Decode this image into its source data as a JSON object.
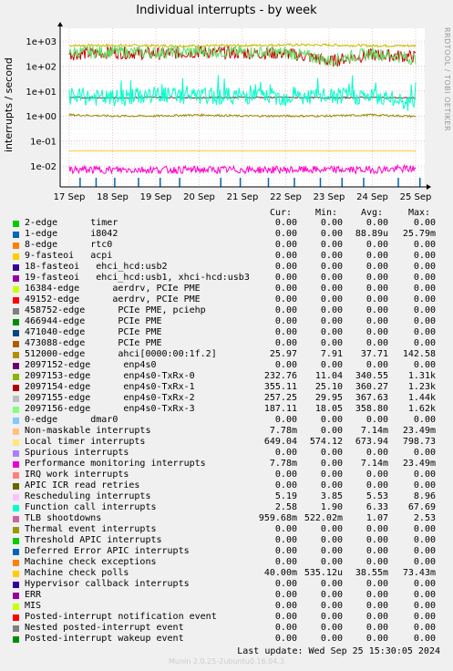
{
  "title": "Individual interrupts - by week",
  "side_label": "RRDTOOL / TOBI OETIKER",
  "ylabel": "interrupts / second",
  "columns": [
    "Cur:",
    "Min:",
    "Avg:",
    "Max:"
  ],
  "footer": "Last update:  Wed Sep 25 15:30:05 2024",
  "munin": "Munin 2.0.25-2ubuntu0.16.04.3",
  "chart_data": {
    "type": "line",
    "title": "Individual interrupts - by week",
    "ylabel": "interrupts / second",
    "yscale": "log",
    "ylim": [
      0.003,
      3000
    ],
    "yticks": [
      "1e+03",
      "1e+02",
      "1e+01",
      "1e+00",
      "1e-01",
      "1e-02"
    ],
    "x": [
      "17 Sep",
      "18 Sep",
      "19 Sep",
      "20 Sep",
      "21 Sep",
      "22 Sep",
      "23 Sep",
      "24 Sep",
      "25 Sep"
    ],
    "grid": true,
    "series": [
      {
        "name": "Local timer interrupts",
        "color": "#CCBB00",
        "values": [
          660,
          670,
          650,
          640,
          660,
          700,
          690,
          650,
          649
        ]
      },
      {
        "name": "2097153-edge enp4s0-TxRx-0",
        "color": "#cc0000",
        "values": [
          300,
          350,
          310,
          360,
          330,
          320,
          150,
          280,
          232
        ]
      },
      {
        "name": "2097156-edge enp4s0-TxRx-3",
        "color": "#66dd66",
        "values": [
          350,
          370,
          340,
          380,
          360,
          340,
          160,
          320,
          187
        ]
      },
      {
        "name": "TLB shootdowns",
        "color": "#998800",
        "values": [
          1.1,
          1.0,
          1.0,
          1.1,
          1.0,
          1.0,
          1.0,
          1.1,
          0.96
        ]
      },
      {
        "name": "Rescheduling interrupts",
        "color": "#664433",
        "values": [
          5.5,
          5.3,
          5.6,
          5.4,
          5.6,
          5.5,
          5.3,
          5.5,
          5.19
        ]
      },
      {
        "name": "Function call interrupts",
        "color": "#00ffcc",
        "values": [
          6.0,
          5.0,
          7.0,
          6.0,
          6.5,
          5.5,
          6.0,
          6.0,
          2.58
        ]
      },
      {
        "name": "Machine check polls",
        "color": "#ffcc33",
        "values": [
          0.04,
          0.04,
          0.04,
          0.04,
          0.04,
          0.04,
          0.04,
          0.04,
          0.04
        ]
      },
      {
        "name": "Non-maskable interrupts",
        "color": "#ff00cc",
        "values": [
          0.007,
          0.007,
          0.007,
          0.007,
          0.007,
          0.007,
          0.007,
          0.007,
          0.0078
        ]
      },
      {
        "name": "1-edge i8042",
        "color": "#0066b3",
        "values": [
          0,
          0,
          0,
          0,
          0,
          0,
          0,
          0,
          0
        ]
      }
    ]
  },
  "legend": [
    {
      "color": "#00cc00",
      "name": "2-edge      timer",
      "cur": "0.00",
      "min": "0.00",
      "avg": "0.00",
      "max": "0.00"
    },
    {
      "color": "#0066b3",
      "name": "1-edge      i8042",
      "cur": "0.00",
      "min": "0.00",
      "avg": "88.89u",
      "max": "25.79m"
    },
    {
      "color": "#ff8000",
      "name": "8-edge      rtc0",
      "cur": "0.00",
      "min": "0.00",
      "avg": "0.00",
      "max": "0.00"
    },
    {
      "color": "#ffcc00",
      "name": "9-fasteoi   acpi",
      "cur": "0.00",
      "min": "0.00",
      "avg": "0.00",
      "max": "0.00"
    },
    {
      "color": "#330099",
      "name": "18-fasteoi   ehci_hcd:usb2",
      "cur": "0.00",
      "min": "0.00",
      "avg": "0.00",
      "max": "0.00"
    },
    {
      "color": "#990099",
      "name": "19-fasteoi   ehci_hcd:usb1, xhci-hcd:usb3",
      "cur": "0.00",
      "min": "0.00",
      "avg": "0.00",
      "max": "0.00"
    },
    {
      "color": "#ccff00",
      "name": "16384-edge      aerdrv, PCIe PME",
      "cur": "0.00",
      "min": "0.00",
      "avg": "0.00",
      "max": "0.00"
    },
    {
      "color": "#ff0000",
      "name": "49152-edge      aerdrv, PCIe PME",
      "cur": "0.00",
      "min": "0.00",
      "avg": "0.00",
      "max": "0.00"
    },
    {
      "color": "#808080",
      "name": "458752-edge      PCIe PME, pciehp",
      "cur": "0.00",
      "min": "0.00",
      "avg": "0.00",
      "max": "0.00"
    },
    {
      "color": "#008f00",
      "name": "466944-edge      PCIe PME",
      "cur": "0.00",
      "min": "0.00",
      "avg": "0.00",
      "max": "0.00"
    },
    {
      "color": "#00487d",
      "name": "471040-edge      PCIe PME",
      "cur": "0.00",
      "min": "0.00",
      "avg": "0.00",
      "max": "0.00"
    },
    {
      "color": "#b35a00",
      "name": "473088-edge      PCIe PME",
      "cur": "0.00",
      "min": "0.00",
      "avg": "0.00",
      "max": "0.00"
    },
    {
      "color": "#b38f00",
      "name": "512000-edge      ahci[0000:00:1f.2]",
      "cur": "25.97",
      "min": "7.91",
      "avg": "37.71",
      "max": "142.58"
    },
    {
      "color": "#6b006b",
      "name": "2097152-edge      enp4s0",
      "cur": "0.00",
      "min": "0.00",
      "avg": "0.00",
      "max": "0.00"
    },
    {
      "color": "#8fb300",
      "name": "2097153-edge      enp4s0-TxRx-0",
      "cur": "232.76",
      "min": "11.04",
      "avg": "340.55",
      "max": "1.31k"
    },
    {
      "color": "#b30000",
      "name": "2097154-edge      enp4s0-TxRx-1",
      "cur": "355.11",
      "min": "25.10",
      "avg": "360.27",
      "max": "1.23k"
    },
    {
      "color": "#bebebe",
      "name": "2097155-edge      enp4s0-TxRx-2",
      "cur": "257.25",
      "min": "29.95",
      "avg": "367.63",
      "max": "1.44k"
    },
    {
      "color": "#80ff80",
      "name": "2097156-edge      enp4s0-TxRx-3",
      "cur": "187.11",
      "min": "18.05",
      "avg": "358.80",
      "max": "1.62k"
    },
    {
      "color": "#80c9ff",
      "name": "0-edge      dmar0",
      "cur": "0.00",
      "min": "0.00",
      "avg": "0.00",
      "max": "0.00"
    },
    {
      "color": "#ffc080",
      "name": "Non-maskable interrupts",
      "cur": "7.78m",
      "min": "0.00",
      "avg": "7.14m",
      "max": "23.49m"
    },
    {
      "color": "#ffe680",
      "name": "Local timer interrupts",
      "cur": "649.04",
      "min": "574.12",
      "avg": "673.94",
      "max": "798.73"
    },
    {
      "color": "#aa80ff",
      "name": "Spurious interrupts",
      "cur": "0.00",
      "min": "0.00",
      "avg": "0.00",
      "max": "0.00"
    },
    {
      "color": "#ee00cc",
      "name": "Performance monitoring interrupts",
      "cur": "7.78m",
      "min": "0.00",
      "avg": "7.14m",
      "max": "23.49m"
    },
    {
      "color": "#ff8080",
      "name": "IRQ work interrupts",
      "cur": "0.00",
      "min": "0.00",
      "avg": "0.00",
      "max": "0.00"
    },
    {
      "color": "#666600",
      "name": "APIC ICR read retries",
      "cur": "0.00",
      "min": "0.00",
      "avg": "0.00",
      "max": "0.00"
    },
    {
      "color": "#ffbfff",
      "name": "Rescheduling interrupts",
      "cur": "5.19",
      "min": "3.85",
      "avg": "5.53",
      "max": "8.96"
    },
    {
      "color": "#00ffcc",
      "name": "Function call interrupts",
      "cur": "2.58",
      "min": "1.90",
      "avg": "6.33",
      "max": "67.69"
    },
    {
      "color": "#cc6699",
      "name": "TLB shootdowns",
      "cur": "959.68m",
      "min": "522.02m",
      "avg": "1.07",
      "max": "2.53"
    },
    {
      "color": "#999900",
      "name": "Thermal event interrupts",
      "cur": "0.00",
      "min": "0.00",
      "avg": "0.00",
      "max": "0.00"
    },
    {
      "color": "#00cc00",
      "name": "Threshold APIC interrupts",
      "cur": "0.00",
      "min": "0.00",
      "avg": "0.00",
      "max": "0.00"
    },
    {
      "color": "#0066b3",
      "name": "Deferred Error APIC interrupts",
      "cur": "0.00",
      "min": "0.00",
      "avg": "0.00",
      "max": "0.00"
    },
    {
      "color": "#ff8000",
      "name": "Machine check exceptions",
      "cur": "0.00",
      "min": "0.00",
      "avg": "0.00",
      "max": "0.00"
    },
    {
      "color": "#ffcc00",
      "name": "Machine check polls",
      "cur": "40.00m",
      "min": "535.12u",
      "avg": "38.55m",
      "max": "73.43m"
    },
    {
      "color": "#330099",
      "name": "Hypervisor callback interrupts",
      "cur": "0.00",
      "min": "0.00",
      "avg": "0.00",
      "max": "0.00"
    },
    {
      "color": "#990099",
      "name": "ERR",
      "cur": "0.00",
      "min": "0.00",
      "avg": "0.00",
      "max": "0.00"
    },
    {
      "color": "#ccff00",
      "name": "MIS",
      "cur": "0.00",
      "min": "0.00",
      "avg": "0.00",
      "max": "0.00"
    },
    {
      "color": "#ff0000",
      "name": "Posted-interrupt notification event",
      "cur": "0.00",
      "min": "0.00",
      "avg": "0.00",
      "max": "0.00"
    },
    {
      "color": "#808080",
      "name": "Nested posted-interrupt event",
      "cur": "0.00",
      "min": "0.00",
      "avg": "0.00",
      "max": "0.00"
    },
    {
      "color": "#008f00",
      "name": "Posted-interrupt wakeup event",
      "cur": "0.00",
      "min": "0.00",
      "avg": "0.00",
      "max": "0.00"
    }
  ]
}
